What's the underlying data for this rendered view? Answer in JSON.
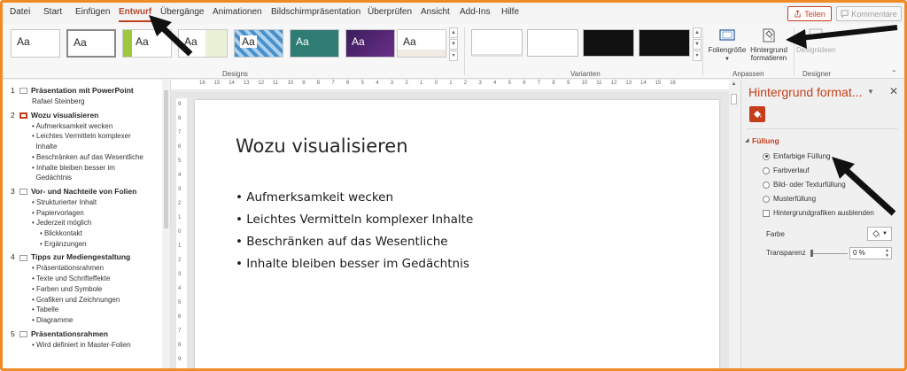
{
  "ribbon_tabs": [
    {
      "label": "Datei"
    },
    {
      "label": "Start"
    },
    {
      "label": "Einfügen"
    },
    {
      "label": "Entwurf"
    },
    {
      "label": "Übergänge"
    },
    {
      "label": "Animationen"
    },
    {
      "label": "Bildschirmpräsentation"
    },
    {
      "label": "Überprüfen"
    },
    {
      "label": "Ansicht"
    },
    {
      "label": "Add-Ins"
    },
    {
      "label": "Hilfe"
    }
  ],
  "active_tab": "Entwurf",
  "share_label": "Teilen",
  "comments_label": "Kommentare",
  "designs": {
    "group_label": "Designs",
    "themes": [
      {
        "label": "Aa"
      },
      {
        "label": "Aa"
      },
      {
        "label": "Aa"
      },
      {
        "label": "Aa"
      },
      {
        "label": "Aa"
      },
      {
        "label": "Aa"
      },
      {
        "label": "Aa"
      },
      {
        "label": "Aa"
      }
    ]
  },
  "variants": {
    "group_label": "Varianten"
  },
  "customize": {
    "group_label": "Anpassen",
    "slide_size_label": "Foliengröße",
    "format_bg_label_line1": "Hintergrund",
    "format_bg_label_line2": "formatieren"
  },
  "designer": {
    "group_label": "Designer",
    "ideas_label": "Designideen"
  },
  "outline": {
    "slides": [
      {
        "num": "1",
        "title": "Präsentation mit PowerPoint",
        "items": [
          {
            "text": "Rafael Steinberg",
            "bullet": false,
            "level": 0
          }
        ]
      },
      {
        "num": "2",
        "title": "Wozu visualisieren",
        "items": [
          {
            "text": "Aufmerksamkeit wecken",
            "bullet": true,
            "level": 1
          },
          {
            "text": "Leichtes Vermitteln komplexer",
            "bullet": true,
            "level": 1
          },
          {
            "text": "Inhalte",
            "bullet": false,
            "level": 1
          },
          {
            "text": "Beschränken auf das Wesentliche",
            "bullet": true,
            "level": 1
          },
          {
            "text": "Inhalte bleiben besser im",
            "bullet": true,
            "level": 1
          },
          {
            "text": "Gedächtnis",
            "bullet": false,
            "level": 1
          }
        ]
      },
      {
        "num": "3",
        "title": "Vor- und Nachteile von Folien",
        "items": [
          {
            "text": "Strukturierter Inhalt",
            "bullet": true,
            "level": 1
          },
          {
            "text": "Papiervorlagen",
            "bullet": true,
            "level": 1
          },
          {
            "text": "Jederzeit möglich",
            "bullet": true,
            "level": 1
          },
          {
            "text": "Blickkontakt",
            "bullet": true,
            "level": 2
          },
          {
            "text": "Ergänzungen",
            "bullet": true,
            "level": 2
          }
        ]
      },
      {
        "num": "4",
        "title": "Tipps zur Mediengestaltung",
        "items": [
          {
            "text": "Präsentationsrahmen",
            "bullet": true,
            "level": 1
          },
          {
            "text": "Texte und Schrifteffekte",
            "bullet": true,
            "level": 1
          },
          {
            "text": "Farben und Symbole",
            "bullet": true,
            "level": 1
          },
          {
            "text": "Grafiken und Zeichnungen",
            "bullet": true,
            "level": 1
          },
          {
            "text": "Tabelle",
            "bullet": true,
            "level": 1
          },
          {
            "text": "Diagramme",
            "bullet": true,
            "level": 1
          }
        ]
      },
      {
        "num": "5",
        "title": "Präsentationsrahmen",
        "items": [
          {
            "text": "Wird definiert in Master-Folien",
            "bullet": true,
            "level": 1
          }
        ]
      }
    ]
  },
  "ruler_h": [
    "16",
    "15",
    "14",
    "13",
    "12",
    "11",
    "10",
    "9",
    "8",
    "7",
    "6",
    "5",
    "4",
    "3",
    "2",
    "1",
    "0",
    "1",
    "2",
    "3",
    "4",
    "5",
    "6",
    "7",
    "8",
    "9",
    "10",
    "11",
    "12",
    "13",
    "14",
    "15",
    "16"
  ],
  "ruler_v": [
    "9",
    "8",
    "7",
    "6",
    "5",
    "4",
    "3",
    "2",
    "1",
    "0",
    "1",
    "2",
    "3",
    "4",
    "5",
    "6",
    "7",
    "8",
    "9"
  ],
  "slide": {
    "title": "Wozu visualisieren",
    "bullets": [
      "Aufmerksamkeit wecken",
      "Leichtes Vermitteln komplexer Inhalte",
      "Beschränken auf das Wesentliche",
      "Inhalte bleiben besser im Gedächtnis"
    ]
  },
  "format_pane": {
    "title": "Hintergrund format...",
    "section": "Füllung",
    "options": [
      {
        "label": "Einfarbige Füllung",
        "selected": true
      },
      {
        "label": "Farbverlauf",
        "selected": false
      },
      {
        "label": "Bild- oder Texturfüllung",
        "selected": false
      },
      {
        "label": "Musterfüllung",
        "selected": false
      }
    ],
    "hide_graphics_label": "Hintergrundgrafiken ausblenden",
    "color_label": "Farbe",
    "transparency_label": "Transparenz",
    "transparency_value": "0 %"
  },
  "colors": {
    "accent": "#c43e1c",
    "frame": "#f08a24"
  }
}
